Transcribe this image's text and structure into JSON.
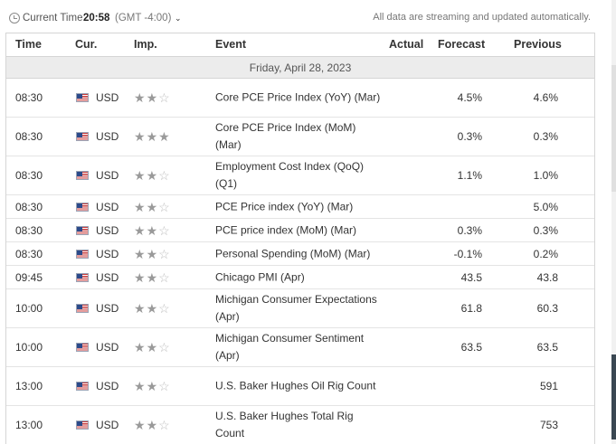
{
  "topbar": {
    "current_time_label": "Current Time:",
    "current_time": "20:58",
    "timezone": "(GMT -4:00)",
    "caret": "⌄",
    "notice": "All data are streaming and updated automatically."
  },
  "table": {
    "headers": {
      "time": "Time",
      "currency": "Cur.",
      "importance": "Imp.",
      "event": "Event",
      "actual": "Actual",
      "forecast": "Forecast",
      "previous": "Previous"
    },
    "date": "Friday, April 28, 2023",
    "rows": [
      {
        "time": "08:30",
        "currency": "USD",
        "importance": 2,
        "event": "Core PCE Price Index (YoY) (Mar)",
        "actual": "",
        "forecast": "4.5%",
        "previous": "4.6%"
      },
      {
        "time": "08:30",
        "currency": "USD",
        "importance": 3,
        "event": "Core PCE Price Index (MoM) (Mar)",
        "actual": "",
        "forecast": "0.3%",
        "previous": "0.3%"
      },
      {
        "time": "08:30",
        "currency": "USD",
        "importance": 2,
        "event": "Employment Cost Index (QoQ) (Q1)",
        "actual": "",
        "forecast": "1.1%",
        "previous": "1.0%"
      },
      {
        "time": "08:30",
        "currency": "USD",
        "importance": 2,
        "event": "PCE Price index (YoY) (Mar)",
        "actual": "",
        "forecast": "",
        "previous": "5.0%"
      },
      {
        "time": "08:30",
        "currency": "USD",
        "importance": 2,
        "event": "PCE price index (MoM) (Mar)",
        "actual": "",
        "forecast": "0.3%",
        "previous": "0.3%"
      },
      {
        "time": "08:30",
        "currency": "USD",
        "importance": 2,
        "event": "Personal Spending (MoM) (Mar)",
        "actual": "",
        "forecast": "-0.1%",
        "previous": "0.2%"
      },
      {
        "time": "09:45",
        "currency": "USD",
        "importance": 2,
        "event": "Chicago PMI (Apr)",
        "actual": "",
        "forecast": "43.5",
        "previous": "43.8"
      },
      {
        "time": "10:00",
        "currency": "USD",
        "importance": 2,
        "event": "Michigan Consumer Expectations (Apr)",
        "actual": "",
        "forecast": "61.8",
        "previous": "60.3"
      },
      {
        "time": "10:00",
        "currency": "USD",
        "importance": 2,
        "event": "Michigan Consumer Sentiment (Apr)",
        "actual": "",
        "forecast": "63.5",
        "previous": "63.5"
      },
      {
        "time": "13:00",
        "currency": "USD",
        "importance": 2,
        "event": "U.S. Baker Hughes Oil Rig Count",
        "actual": "",
        "forecast": "",
        "previous": "591"
      },
      {
        "time": "13:00",
        "currency": "USD",
        "importance": 2,
        "event": "U.S. Baker Hughes Total Rig Count",
        "actual": "",
        "forecast": "",
        "previous": "753"
      }
    ]
  },
  "icons": {
    "clock": "clock-icon",
    "flag": "us-flag-icon",
    "star": "star-icon"
  },
  "colors": {
    "header_border": "#d5d5d5",
    "date_row_bg": "#ececec",
    "star_filled": "#9a9a9a",
    "star_empty": "#bdbdbd"
  }
}
